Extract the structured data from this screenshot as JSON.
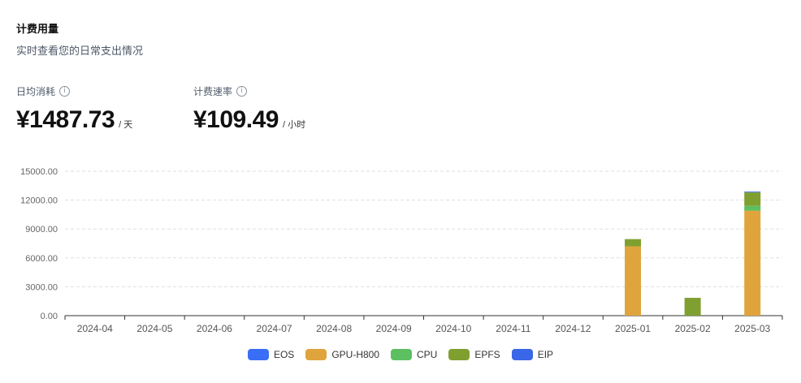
{
  "header": {
    "title": "计费用量",
    "subtitle": "实时查看您的日常支出情况"
  },
  "metrics": [
    {
      "label": "日均消耗",
      "value": "¥1487.73",
      "unit": "/ 天",
      "icon": "info-icon"
    },
    {
      "label": "计费速率",
      "value": "¥109.49",
      "unit": "/ 小时",
      "icon": "info-icon"
    }
  ],
  "chart_data": {
    "type": "bar",
    "stacked": true,
    "categories": [
      "2024-04",
      "2024-05",
      "2024-06",
      "2024-07",
      "2024-08",
      "2024-09",
      "2024-10",
      "2024-11",
      "2024-12",
      "2025-01",
      "2025-02",
      "2025-03"
    ],
    "series": [
      {
        "name": "EOS",
        "color": "#3b6ef6",
        "values": [
          0,
          0,
          0,
          0,
          0,
          0,
          0,
          0,
          0,
          0,
          0,
          0
        ]
      },
      {
        "name": "GPU-H800",
        "color": "#e0a43c",
        "values": [
          0,
          0,
          0,
          0,
          0,
          0,
          0,
          0,
          0,
          7200,
          0,
          10900
        ]
      },
      {
        "name": "CPU",
        "color": "#5cbf60",
        "values": [
          0,
          0,
          0,
          0,
          0,
          0,
          0,
          0,
          0,
          0,
          0,
          500
        ]
      },
      {
        "name": "EPFS",
        "color": "#7fa030",
        "values": [
          0,
          0,
          0,
          0,
          0,
          0,
          0,
          0,
          0,
          750,
          1850,
          1400
        ]
      },
      {
        "name": "EIP",
        "color": "#3a66e8",
        "values": [
          0,
          0,
          0,
          0,
          0,
          0,
          0,
          0,
          0,
          0,
          0,
          80
        ]
      }
    ],
    "yticks": [
      "15000.00",
      "12000.00",
      "9000.00",
      "6000.00",
      "3000.00",
      "0.00"
    ],
    "ylim": [
      0,
      15000
    ],
    "grid": true,
    "legend_position": "bottom-center"
  }
}
